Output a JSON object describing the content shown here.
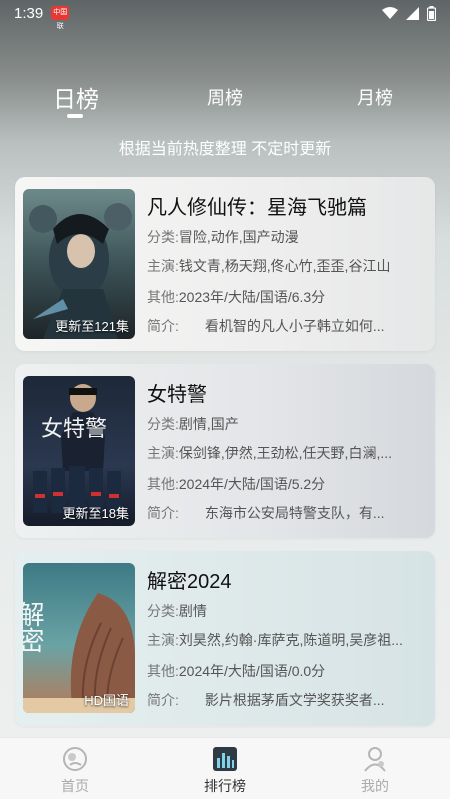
{
  "status_bar": {
    "time": "1:39",
    "app_badge": "中国联"
  },
  "tabs": [
    {
      "label": "日榜",
      "active": true
    },
    {
      "label": "周榜",
      "active": false
    },
    {
      "label": "月榜",
      "active": false
    }
  ],
  "subtitle": "根据当前热度整理 不定时更新",
  "cards": [
    {
      "title": "凡人修仙传：星海飞驰篇",
      "badge": "更新至121集",
      "genre_label": "分类:",
      "genre": "冒险,动作,国产动漫",
      "cast_label": "主演:",
      "cast": "钱文青,杨天翔,佟心竹,歪歪,谷江山",
      "other_label": "其他:",
      "other": "2023年/大陆/国语/6.3分",
      "intro_label": "简介:",
      "intro": "看机智的凡人小子韩立如何..."
    },
    {
      "title": "女特警",
      "badge": "更新至18集",
      "genre_label": "分类:",
      "genre": "剧情,国产",
      "cast_label": "主演:",
      "cast": "保剑锋,伊然,王劲松,任天野,白澜,...",
      "other_label": "其他:",
      "other": "2024年/大陆/国语/5.2分",
      "intro_label": "简介:",
      "intro": "东海市公安局特警支队，有..."
    },
    {
      "title": "解密2024",
      "badge": "HD国语",
      "genre_label": "分类:",
      "genre": "剧情",
      "cast_label": "主演:",
      "cast": "刘昊然,约翰·库萨克,陈道明,吴彦祖...",
      "other_label": "其他:",
      "other": "2024年/大陆/国语/0.0分",
      "intro_label": "简介:",
      "intro": "影片根据茅盾文学奖获奖者..."
    }
  ],
  "poster_texts": {
    "card2": "女特警",
    "card3": "解密"
  },
  "bottom_nav": [
    {
      "label": "首页",
      "icon": "home-icon"
    },
    {
      "label": "排行榜",
      "icon": "rank-icon",
      "active": true
    },
    {
      "label": "我的",
      "icon": "profile-icon"
    }
  ]
}
